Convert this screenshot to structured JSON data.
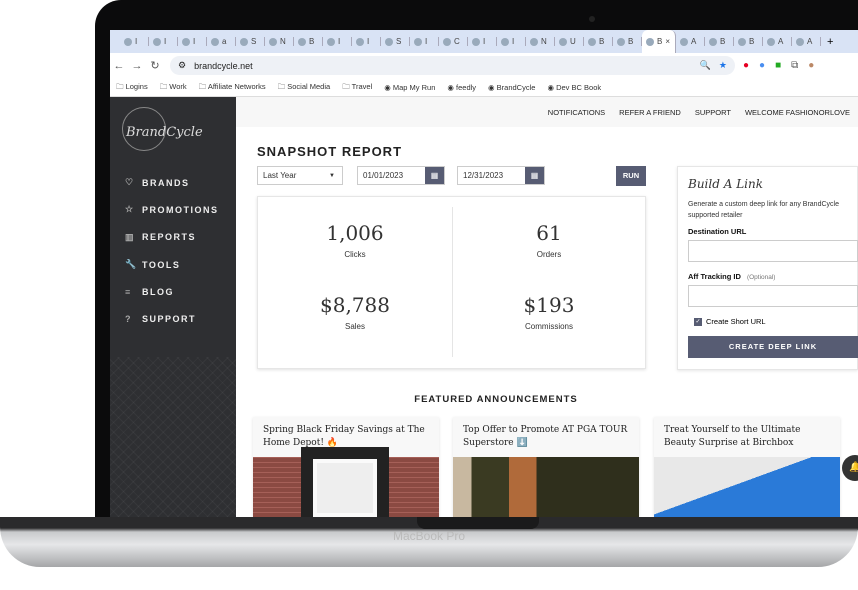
{
  "browser": {
    "tabs": [
      "I",
      "I",
      "I",
      "a",
      "S",
      "N",
      "B",
      "I",
      "I",
      "S",
      "I",
      "C",
      "I",
      "I",
      "N",
      "U",
      "B",
      "B",
      "B",
      "A",
      "B",
      "B",
      "A",
      "A"
    ],
    "active_tab_close": "×",
    "new_tab": "+",
    "url": "brandcycle.net",
    "bookmarks": [
      "Logins",
      "Work",
      "Affiliate Networks",
      "Social Media",
      "Travel",
      "Map My Run",
      "feedly",
      "BrandCycle",
      "Dev BC Book"
    ]
  },
  "sidebar": {
    "logo": "BrandCycle",
    "items": [
      {
        "icon": "heart-icon",
        "glyph": "♡",
        "label": "BRANDS"
      },
      {
        "icon": "star-icon",
        "glyph": "☆",
        "label": "PROMOTIONS"
      },
      {
        "icon": "bar-chart-icon",
        "glyph": "▥",
        "label": "REPORTS"
      },
      {
        "icon": "wrench-icon",
        "glyph": "🔧",
        "label": "TOOLS"
      },
      {
        "icon": "lines-icon",
        "glyph": "≡",
        "label": "BLOG"
      },
      {
        "icon": "question-icon",
        "glyph": "?",
        "label": "SUPPORT"
      }
    ]
  },
  "header": {
    "links": [
      "NOTIFICATIONS",
      "REFER A FRIEND",
      "SUPPORT",
      "WELCOME FASHIONORLOVE"
    ]
  },
  "report": {
    "title": "SNAPSHOT REPORT",
    "range": "Last Year",
    "start": "01/01/2023",
    "end": "12/31/2023",
    "run": "RUN",
    "stats": [
      {
        "value": "1,006",
        "label": "Clicks"
      },
      {
        "value": "61",
        "label": "Orders"
      },
      {
        "value": "$8,788",
        "label": "Sales"
      },
      {
        "value": "$193",
        "label": "Commissions"
      }
    ]
  },
  "build_link": {
    "title": "Build A Link",
    "desc": "Generate a custom deep link for any BrandCycle supported retailer",
    "dest_label": "Destination URL",
    "aff_label": "Aff Tracking ID",
    "optional": "(Optional)",
    "short_url": "Create Short URL",
    "short_url_checked": true,
    "button": "CREATE DEEP LINK"
  },
  "announcements": {
    "title": "FEATURED ANNOUNCEMENTS",
    "cards": [
      {
        "title": "Spring Black Friday Savings at The Home Depot! 🔥"
      },
      {
        "title": "Top Offer to Promote AT PGA TOUR Superstore ⬇️"
      },
      {
        "title": "Treat Yourself to the Ultimate Beauty Surprise at Birchbox"
      }
    ]
  },
  "device": {
    "label": "MacBook Pro"
  },
  "colors": {
    "accent": "#575c73",
    "sidebar": "#2e2f32"
  }
}
